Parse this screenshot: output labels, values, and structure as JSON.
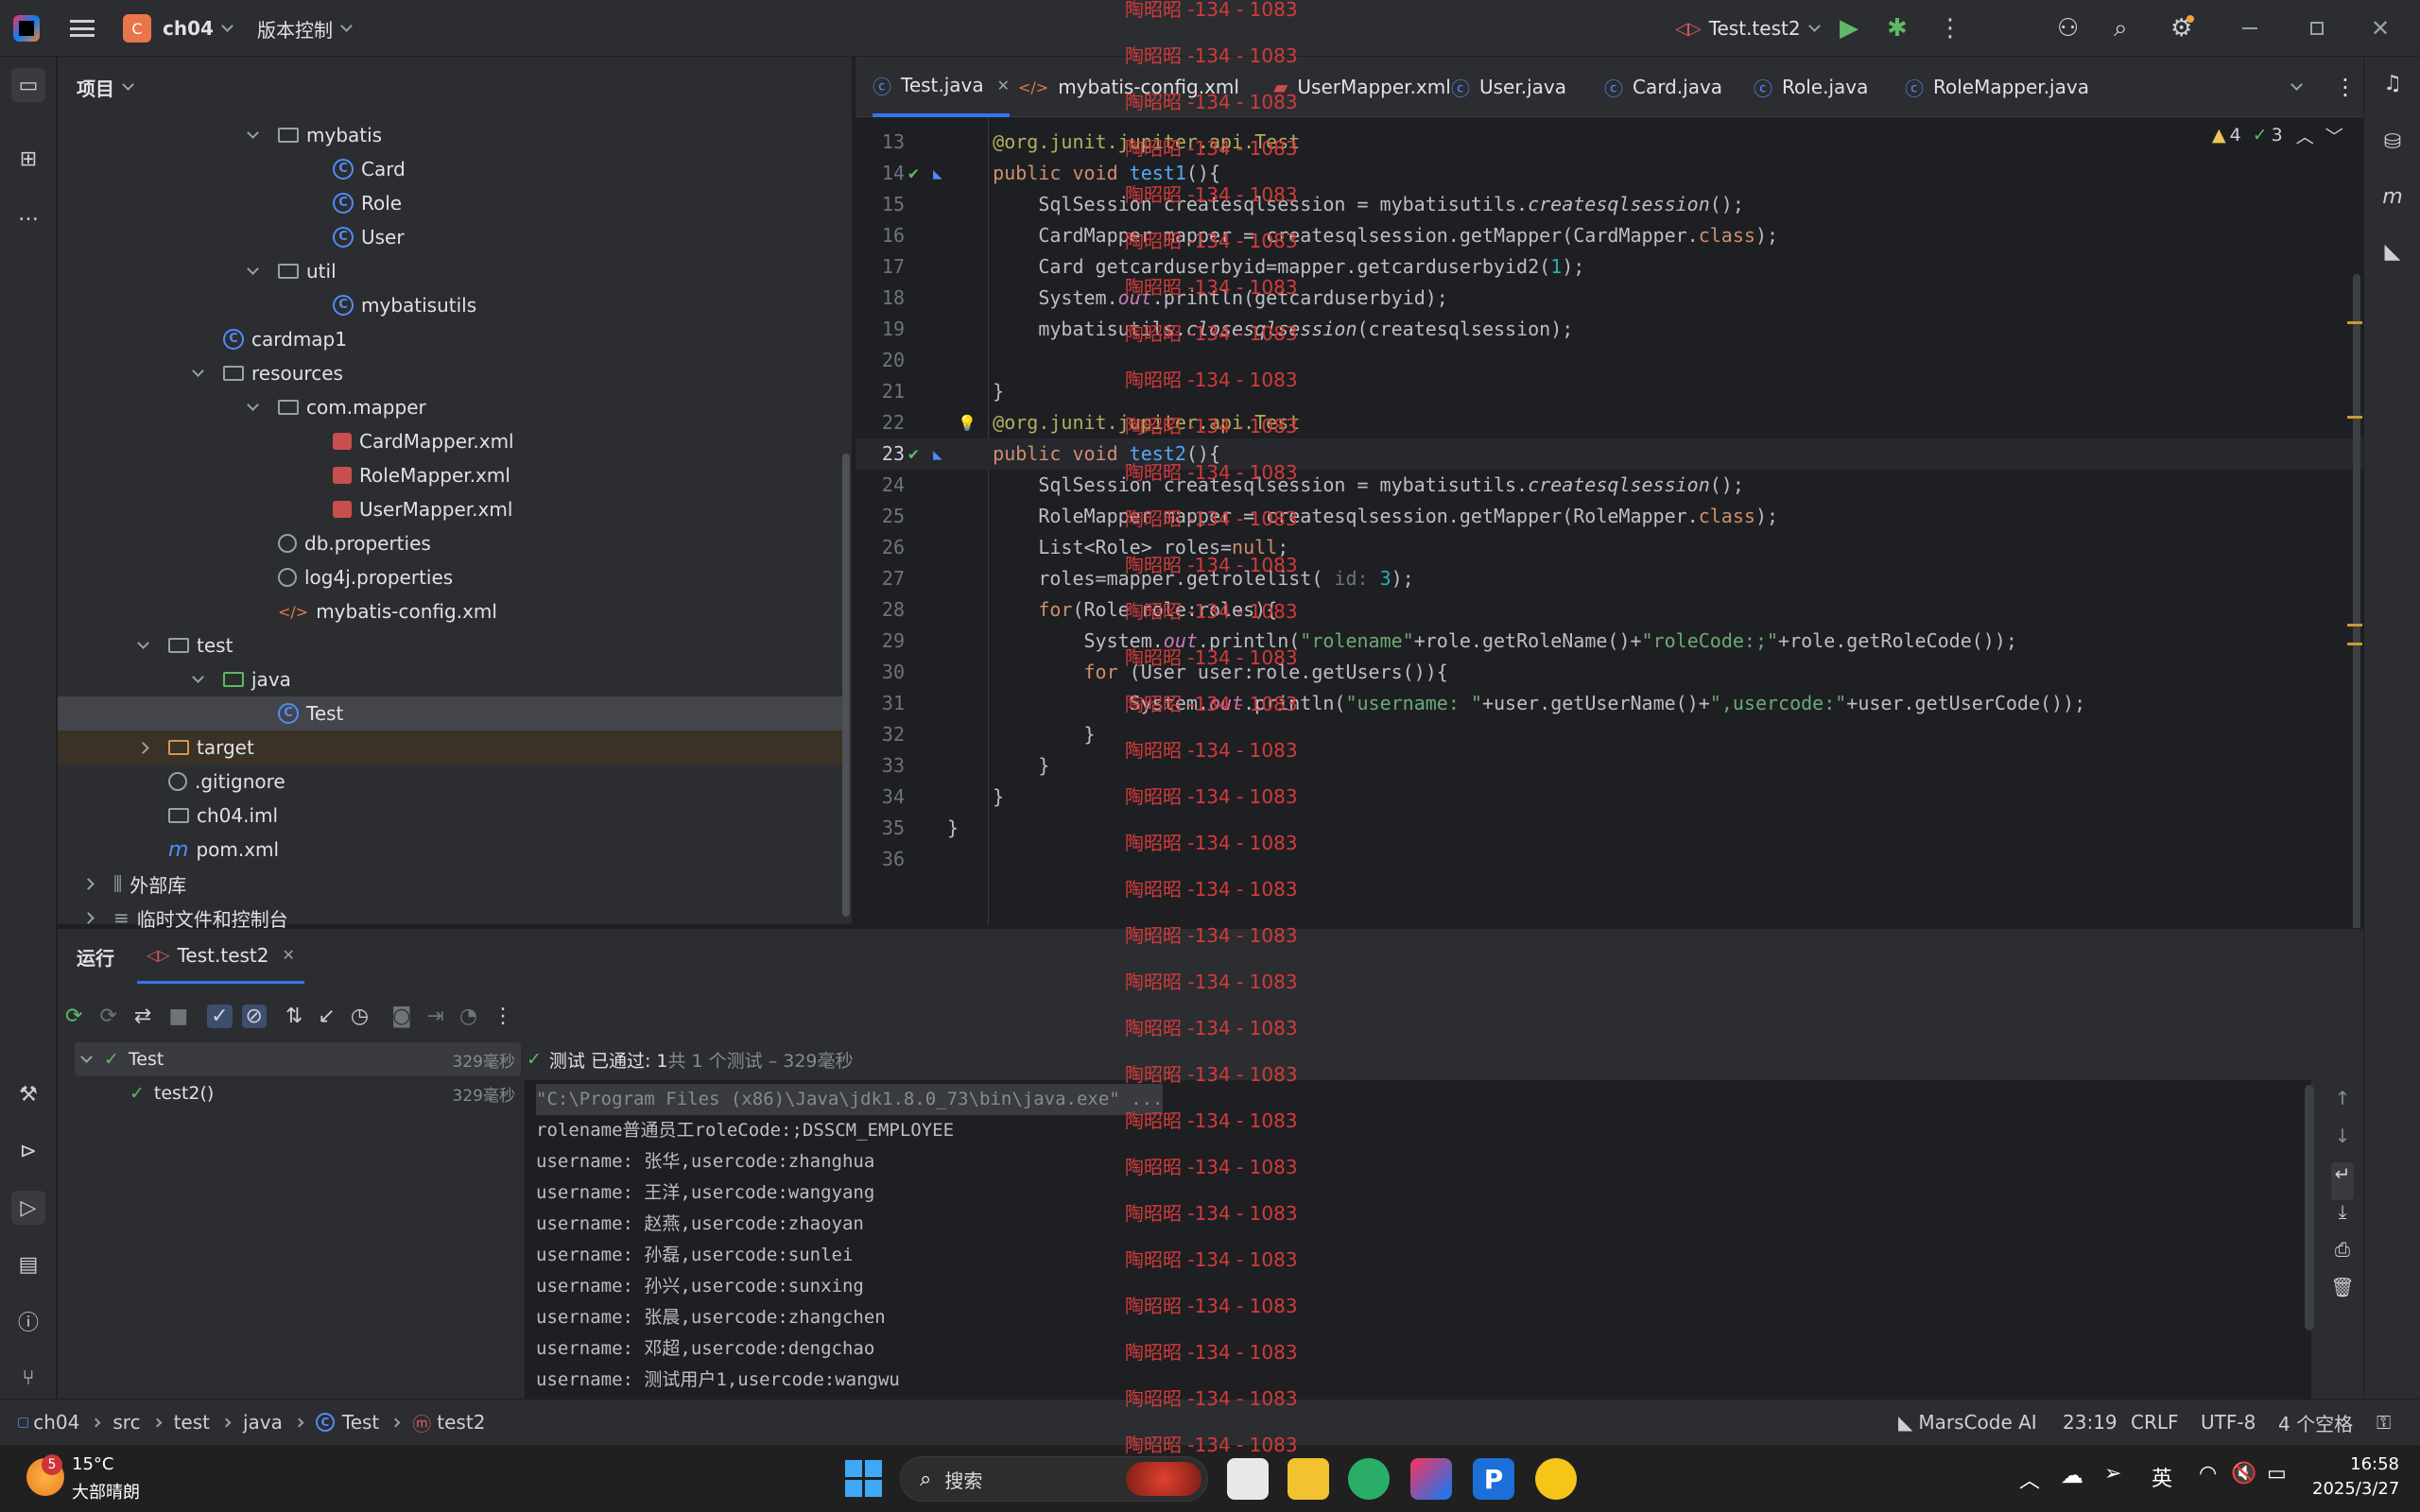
{
  "titlebar": {
    "project_badge": "C",
    "project": "ch04",
    "vcs": "版本控制",
    "run_config": "Test.test2",
    "accent": "#e8764a"
  },
  "project_panel": {
    "title": "项目",
    "items": [
      {
        "label": "mybatis",
        "type": "package",
        "indent": 3,
        "expanded": true
      },
      {
        "label": "Card",
        "type": "class",
        "indent": 4
      },
      {
        "label": "Role",
        "type": "class",
        "indent": 4
      },
      {
        "label": "User",
        "type": "class",
        "indent": 4
      },
      {
        "label": "util",
        "type": "package",
        "indent": 3,
        "expanded": true
      },
      {
        "label": "mybatisutils",
        "type": "class",
        "indent": 4
      },
      {
        "label": "cardmap1",
        "type": "class",
        "indent": 2
      },
      {
        "label": "resources",
        "type": "folder",
        "indent": 2,
        "expanded": true
      },
      {
        "label": "com.mapper",
        "type": "folder",
        "indent": 3,
        "expanded": true
      },
      {
        "label": "CardMapper.xml",
        "type": "xml",
        "indent": 4
      },
      {
        "label": "RoleMapper.xml",
        "type": "xml",
        "indent": 4
      },
      {
        "label": "UserMapper.xml",
        "type": "xml",
        "indent": 4
      },
      {
        "label": "db.properties",
        "type": "props",
        "indent": 3
      },
      {
        "label": "log4j.properties",
        "type": "props",
        "indent": 3
      },
      {
        "label": "mybatis-config.xml",
        "type": "xmlcfg",
        "indent": 3
      },
      {
        "label": "test",
        "type": "folder",
        "indent": 1,
        "expanded": true
      },
      {
        "label": "java",
        "type": "folder-green",
        "indent": 2,
        "expanded": true
      },
      {
        "label": "Test",
        "type": "class",
        "indent": 3,
        "selected": true
      },
      {
        "label": "target",
        "type": "folder-orange",
        "indent": 1,
        "expanded": false
      },
      {
        "label": ".gitignore",
        "type": "ignore",
        "indent": 1
      },
      {
        "label": "ch04.iml",
        "type": "file",
        "indent": 1
      },
      {
        "label": "pom.xml",
        "type": "maven",
        "indent": 1
      },
      {
        "label": "外部库",
        "type": "lib",
        "indent": 0,
        "expanded": false
      },
      {
        "label": "临时文件和控制台",
        "type": "scratch",
        "indent": 0,
        "expanded": false
      }
    ]
  },
  "tabs": [
    {
      "label": "Test.java",
      "active": true,
      "closable": true
    },
    {
      "label": "mybatis-config.xml"
    },
    {
      "label": "UserMapper.xml"
    },
    {
      "label": "User.java"
    },
    {
      "label": "Card.java"
    },
    {
      "label": "Role.java"
    },
    {
      "label": "RoleMapper.java"
    }
  ],
  "inspections": {
    "warnings": "4",
    "ok": "3"
  },
  "code_lines": [
    {
      "n": "13",
      "html": "    <span class='ann'>@org.junit.jupiter.api.Test</span>"
    },
    {
      "n": "14",
      "html": "    <span class='kw'>public void</span> <span class='fn'>test1</span>(){"
    },
    {
      "n": "15",
      "html": "        SqlSession createsqlsession = mybatisutils.<span class='it'>createsqlsession</span>();"
    },
    {
      "n": "16",
      "html": "        CardMapper mapper = createsqlsession.getMapper(CardMapper.<span class='kw'>class</span>);"
    },
    {
      "n": "17",
      "html": "        Card getcarduserbyid=mapper.getcarduserbyid2(<span class='num'>1</span>);"
    },
    {
      "n": "18",
      "html": "        System.<span class='fld'>out</span>.println(getcarduserbyid);"
    },
    {
      "n": "19",
      "html": "        mybatisutils.<span class='it'>closesqlsession</span>(createsqlsession);"
    },
    {
      "n": "20",
      "html": ""
    },
    {
      "n": "21",
      "html": "    }"
    },
    {
      "n": "22",
      "html": "    <span class='ann'>@org.junit.jupiter.api.Test</span>"
    },
    {
      "n": "23",
      "html": "    <span class='kw'>public void</span> <span class='fn'>test2</span>(){"
    },
    {
      "n": "24",
      "html": "        SqlSession createsqlsession = mybatisutils.<span class='it'>createsqlsession</span>();"
    },
    {
      "n": "25",
      "html": "        RoleMapper mapper = createsqlsession.getMapper(RoleMapper.<span class='kw'>class</span>);"
    },
    {
      "n": "26",
      "html": "        List&lt;Role&gt; roles=<span class='kw'>null</span>;"
    },
    {
      "n": "27",
      "html": "        roles=mapper.getrolelist( <span style='color:#6f737a'>id:</span> <span class='num'>3</span>);"
    },
    {
      "n": "28",
      "html": "        <span class='kw'>for</span>(Role role:roles){"
    },
    {
      "n": "29",
      "html": "            System.<span class='fld'>out</span>.println(<span class='str'>\"rolename\"</span>+role.getRoleName()+<span class='str'>\"roleCode:;\"</span>+role.getRoleCode());"
    },
    {
      "n": "30",
      "html": "            <span class='kw'>for</span> (User user:role.getUsers()){"
    },
    {
      "n": "31",
      "html": "                System.<span class='fld'>out</span>.println(<span class='str'>\"username: \"</span>+user.getUserName()+<span class='str'>\",usercode:\"</span>+user.getUserCode());"
    },
    {
      "n": "32",
      "html": "            }"
    },
    {
      "n": "33",
      "html": "        }"
    },
    {
      "n": "34",
      "html": "    }"
    },
    {
      "n": "35",
      "html": "}"
    },
    {
      "n": "36",
      "html": ""
    }
  ],
  "run": {
    "label": "运行",
    "tab": "Test.test2",
    "tree": [
      {
        "label": "Test",
        "time": "329毫秒"
      },
      {
        "label": "test2()",
        "time": "329毫秒"
      }
    ],
    "status_pass": "测试 已通过: 1",
    "status_rest": "共 1 个测试 – 329毫秒",
    "console": [
      "\"C:\\Program Files (x86)\\Java\\jdk1.8.0_73\\bin\\java.exe\" ...",
      "rolename普通员工roleCode:;DSSCM_EMPLOYEE",
      "username: 张华,usercode:zhanghua",
      "username: 王洋,usercode:wangyang",
      "username: 赵燕,usercode:zhaoyan",
      "username: 孙磊,usercode:sunlei",
      "username: 孙兴,usercode:sunxing",
      "username: 张晨,usercode:zhangchen",
      "username: 邓超,usercode:dengchao",
      "username: 测试用户1,usercode:wangwu"
    ]
  },
  "statusbar": {
    "breadcrumb": [
      "ch04",
      "src",
      "test",
      "java",
      "Test",
      "test2"
    ],
    "marscode": "MarsCode AI",
    "position": "23:19",
    "line_sep": "CRLF",
    "encoding": "UTF-8",
    "indent": "4 个空格"
  },
  "watermark": "陶昭昭 -134 - 1083",
  "taskbar": {
    "weather_badge": "5",
    "temp": "15°C",
    "weather": "大部晴朗",
    "search": "搜索",
    "ime": "英",
    "time": "16:58",
    "date": "2025/3/27"
  }
}
